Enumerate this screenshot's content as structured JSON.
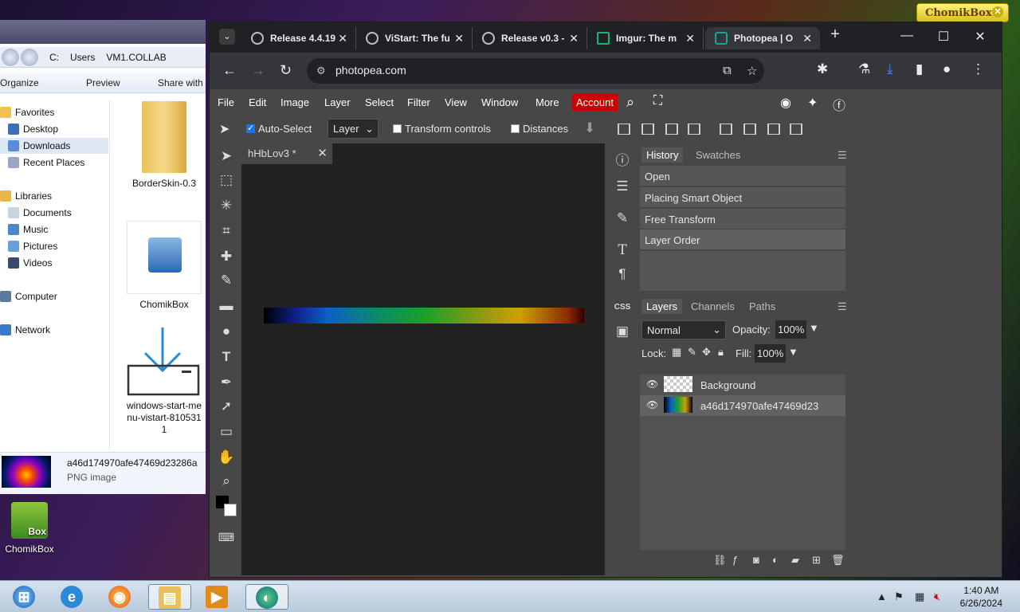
{
  "explorer": {
    "address": [
      "C:",
      "Users",
      "VM1.COLLAB"
    ],
    "commands": [
      "Organize",
      "Preview",
      "Share with"
    ],
    "nav": {
      "favorites": "Favorites",
      "desktop": "Desktop",
      "downloads": "Downloads",
      "recent": "Recent Places",
      "libraries": "Libraries",
      "documents": "Documents",
      "music": "Music",
      "pictures": "Pictures",
      "videos": "Videos",
      "computer": "Computer",
      "network": "Network"
    },
    "files": [
      {
        "name": "BorderSkin-0.3"
      },
      {
        "name": "ChomikBox"
      },
      {
        "name": "windows-start-menu-vistart-8105311"
      }
    ],
    "details": {
      "name": "a46d174970afe47469d23286a",
      "type": "PNG image"
    }
  },
  "desktop": {
    "chomik_label": "ChomikBox",
    "chomik_box": "Box",
    "badge": "ChomikBox",
    "badge_close": "✕"
  },
  "browser": {
    "tabs": [
      {
        "title": "Release 4.4.19",
        "close": "✕"
      },
      {
        "title": "ViStart: The fu",
        "close": "✕"
      },
      {
        "title": "Release v0.3 -",
        "close": "✕"
      },
      {
        "title": "Imgur: The m",
        "close": "✕"
      },
      {
        "title": "Photopea | O",
        "close": "✕"
      }
    ],
    "new_tab": "+",
    "window_controls": {
      "minimize": "—",
      "maximize": "☐",
      "close": "✕"
    },
    "url": "photopea.com"
  },
  "photopea": {
    "menu": [
      "File",
      "Edit",
      "Image",
      "Layer",
      "Select",
      "Filter",
      "View",
      "Window",
      "More"
    ],
    "account": "Account",
    "options": {
      "auto_select": "Auto-Select",
      "layer_select": "Layer",
      "transform_controls": "Transform controls",
      "distances": "Distances"
    },
    "doc_tab": {
      "title": "hHbLov3",
      "modified": "*",
      "close": "✕"
    },
    "history_panel": {
      "tabs": [
        "History",
        "Swatches"
      ],
      "items": [
        "Open",
        "Placing Smart Object",
        "Free Transform",
        "Layer Order"
      ]
    },
    "layers_panel": {
      "tabs": [
        "Layers",
        "Channels",
        "Paths"
      ],
      "blend_mode": "Normal",
      "opacity_label": "Opacity:",
      "opacity_value": "100%",
      "lock_label": "Lock:",
      "fill_label": "Fill:",
      "fill_value": "100%",
      "layers": [
        {
          "name": "Background"
        },
        {
          "name": "a46d174970afe47469d23"
        }
      ]
    }
  },
  "taskbar": {
    "time": "1:40 AM",
    "date": "6/26/2024"
  }
}
